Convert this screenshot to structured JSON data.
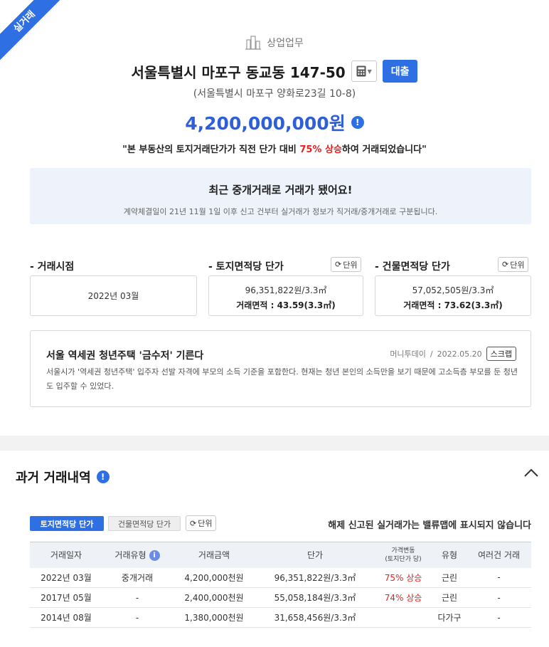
{
  "ribbon": {
    "label": "실거래"
  },
  "header": {
    "category": "상업업무",
    "address": "서울특별시 마포구 동교동 147-50",
    "loan_label": "대출",
    "road_address": "(서울특별시 마포구 양화로23길 10-8)",
    "price": "4,200,000,000원",
    "rise_prefix": "\"본 부동산의 토지거래단가가 직전 단가 대비 ",
    "rise_highlight": "75% 상승",
    "rise_suffix": "하여 거래되었습니다\""
  },
  "notice": {
    "title": "최근 중개거래로 거래가 됐어요!",
    "subtitle": "계약체결일이 21년 11월 1일 이후 신고 건부터 실거래가 정보가 직거래/중개거래로 구분됩니다."
  },
  "summary": {
    "date_label": "- 거래시점",
    "date_value": "2022년 03월",
    "land_label": "- 토지면적당 단가",
    "land_price": "96,351,822원/3.3㎡",
    "land_area": "거래면적 : 43.59(3.3㎡)",
    "building_label": "- 건물면적당 단가",
    "building_price": "57,052,505원/3.3㎡",
    "building_area": "거래면적 : 73.62(3.3㎡)",
    "unit_label": "단위"
  },
  "news": {
    "title": "서울 역세권 청년주택 '금수저' 기른다",
    "source": "머니투데이",
    "separator": "/",
    "date": "2022.05.20",
    "scrap_label": "스크랩",
    "body": "서울시가 '역세권 청년주택' 입주자 선발 자격에 부모의 소득 기준을 포함한다. 현재는 청년 본인의 소득만을 보기 때문에 고소득층 부모를 둔 청년도 입주할 수 있었다."
  },
  "history": {
    "title": "과거 거래내역",
    "tab_land": "토지면적당 단가",
    "tab_building": "건물면적당 단가",
    "unit_label": "단위",
    "note": "해제 신고된 실거래가는 밸류맵에 표시되지 않습니다",
    "columns": {
      "date": "거래일자",
      "type": "거래유형",
      "amount": "거래금액",
      "unit_price": "단가",
      "change_1": "가격변동",
      "change_2": "(토지단가 당)",
      "kind": "유형",
      "multi": "여러건 거래"
    },
    "rows": [
      {
        "date": "2022년 03월",
        "type": "중개거래",
        "amount": "4,200,000천원",
        "unit_price": "96,351,822원/3.3㎡",
        "change": "75% 상승",
        "kind": "근린",
        "multi": "-"
      },
      {
        "date": "2017년 05월",
        "type": "-",
        "amount": "2,400,000천원",
        "unit_price": "55,058,184원/3.3㎡",
        "change": "74% 상승",
        "kind": "근린",
        "multi": "-"
      },
      {
        "date": "2014년 08월",
        "type": "-",
        "amount": "1,380,000천원",
        "unit_price": "31,658,456원/3.3㎡",
        "change": "",
        "kind": "다가구",
        "multi": "-"
      }
    ]
  },
  "colors": {
    "accent": "#2f6fe4",
    "rise": "#e02424",
    "notice_bg": "#eef2fb"
  }
}
